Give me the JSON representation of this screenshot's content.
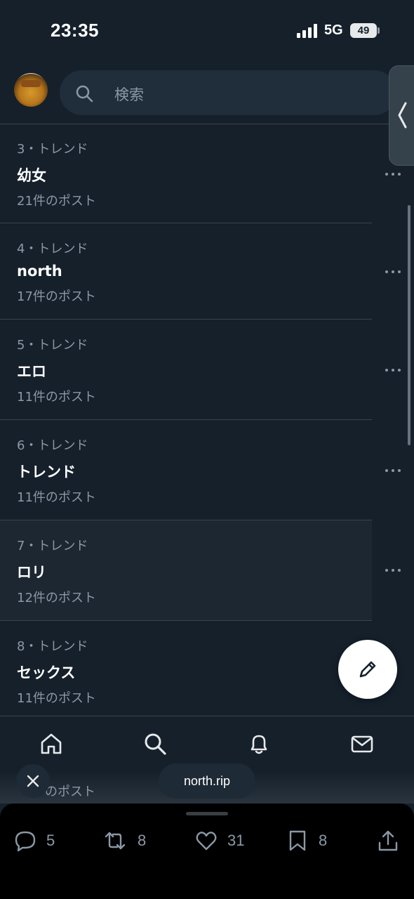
{
  "status_bar": {
    "time": "23:35",
    "network": "5G",
    "battery": "49"
  },
  "header": {
    "search_placeholder": "検索"
  },
  "trends": [
    {
      "rank": "3・トレンド",
      "name": "幼女",
      "count": "21件のポスト"
    },
    {
      "rank": "4・トレンド",
      "name": "north",
      "count": "17件のポスト"
    },
    {
      "rank": "5・トレンド",
      "name": "エロ",
      "count": "11件のポスト"
    },
    {
      "rank": "6・トレンド",
      "name": "トレンド",
      "count": "11件のポスト"
    },
    {
      "rank": "7・トレンド",
      "name": "ロリ",
      "count": "12件のポスト"
    },
    {
      "rank": "8・トレンド",
      "name": "セックス",
      "count": "11件のポスト"
    }
  ],
  "partial_trend_count": "のポスト",
  "url_pill": "north.rip",
  "actions": {
    "replies": "5",
    "reposts": "8",
    "likes": "31",
    "bookmarks": "8"
  },
  "colors": {
    "background": "#15202b",
    "divider": "#38444d",
    "muted_text": "#8b98a5",
    "fab": "#ffffff"
  },
  "icons": [
    "search-icon",
    "more-icon",
    "compose-icon",
    "home-icon",
    "bell-icon",
    "mail-icon",
    "close-icon",
    "reply-icon",
    "repost-icon",
    "like-icon",
    "bookmark-icon",
    "share-icon"
  ]
}
